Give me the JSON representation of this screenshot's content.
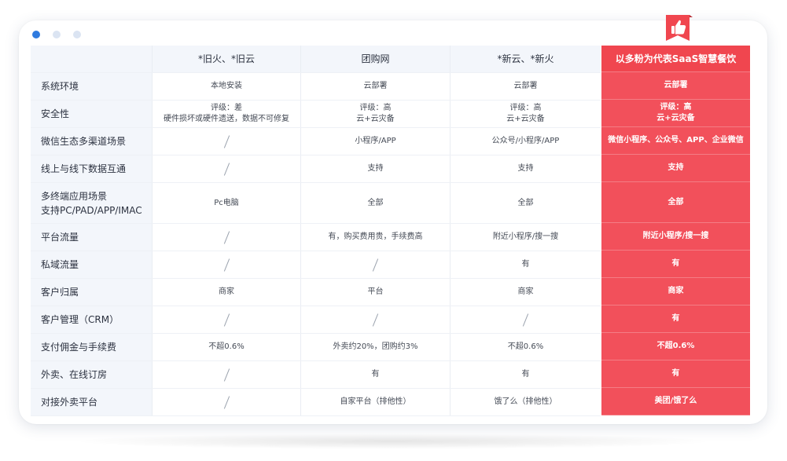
{
  "colors": {
    "accent": "#f2505b",
    "header_bg": "#f3f6fb",
    "dot_active": "#2f7bdf",
    "dot_inactive": "#dbe4f2"
  },
  "window": {
    "dots": [
      "active",
      "inactive",
      "inactive"
    ]
  },
  "table": {
    "headers": [
      "",
      "*旧火、*旧云",
      "团购网",
      "*新云、*新火"
    ],
    "highlight_header": "以多粉为代表SaaS智慧餐饮",
    "badge_icon": "thumbs-up-icon",
    "rows": [
      {
        "label": "系统环境",
        "cells": [
          "本地安装",
          "云部署",
          "云部署"
        ],
        "highlight": "云部署"
      },
      {
        "label": "安全性",
        "cells": [
          "评级：差\n硬件损坏或硬件遗送，数据不可修复",
          "评级：高\n云+云灾备",
          "评级：高\n云+云灾备"
        ],
        "highlight": "评级：高\n云+云灾备"
      },
      {
        "label": "微信生态多渠道场景",
        "cells": [
          "/",
          "小程序/APP",
          "公众号/小程序/APP"
        ],
        "highlight": "微信小程序、公众号、APP、企业微信"
      },
      {
        "label": "线上与线下数据互通",
        "cells": [
          "/",
          "支持",
          "支持"
        ],
        "highlight": "支持"
      },
      {
        "label": "多终端应用场景\n支持PC/PAD/APP/IMAC",
        "cells": [
          "Pc电脑",
          "全部",
          "全部"
        ],
        "highlight": "全部"
      },
      {
        "label": "平台流量",
        "cells": [
          "/",
          "有，购买费用贵，手续费高",
          "附近小程序/搜一搜"
        ],
        "highlight": "附近小程序/搜一搜"
      },
      {
        "label": "私域流量",
        "cells": [
          "/",
          "/",
          "有"
        ],
        "highlight": "有"
      },
      {
        "label": "客户归属",
        "cells": [
          "商家",
          "平台",
          "商家"
        ],
        "highlight": "商家"
      },
      {
        "label": "客户管理（CRM）",
        "cells": [
          "/",
          "/",
          "/"
        ],
        "highlight": "有"
      },
      {
        "label": "支付佣金与手续费",
        "cells": [
          "不超0.6%",
          "外卖约20%，团购约3%",
          "不超0.6%"
        ],
        "highlight": "不超0.6%"
      },
      {
        "label": "外卖、在线订房",
        "cells": [
          "/",
          "有",
          "有"
        ],
        "highlight": "有"
      },
      {
        "label": "对接外卖平台",
        "cells": [
          "/",
          "自家平台（排他性）",
          "饿了么（排他性）"
        ],
        "highlight": "美团/饿了么"
      }
    ]
  }
}
